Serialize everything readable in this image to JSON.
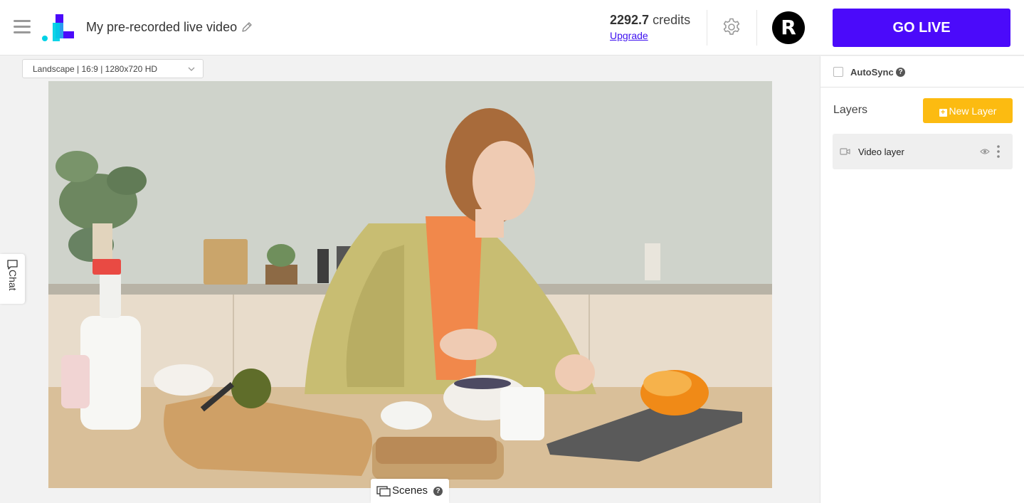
{
  "header": {
    "project_title": "My pre-recorded live video",
    "credits_value": "2292.7",
    "credits_unit": "credits",
    "upgrade_label": "Upgrade",
    "avatar_initial": "R",
    "go_live_label": "GO LIVE"
  },
  "canvas": {
    "format_selected": "Landscape | 16:9 | 1280x720 HD",
    "chat_label": "Chat",
    "scenes_label": "Scenes",
    "help_symbol": "?"
  },
  "panel": {
    "autosync_label": "AutoSync",
    "autosync_checked": false,
    "help_symbol": "?",
    "layers_title": "Layers",
    "new_layer_label": "New Layer",
    "layers": [
      {
        "name": "Video layer",
        "icon": "video-camera-icon"
      }
    ]
  },
  "colors": {
    "go_live": "#4b0afa",
    "new_layer": "#fcbb11",
    "link": "#3d10f0",
    "logo_blue": "#3d10f0",
    "logo_cyan": "#00d2e6"
  }
}
